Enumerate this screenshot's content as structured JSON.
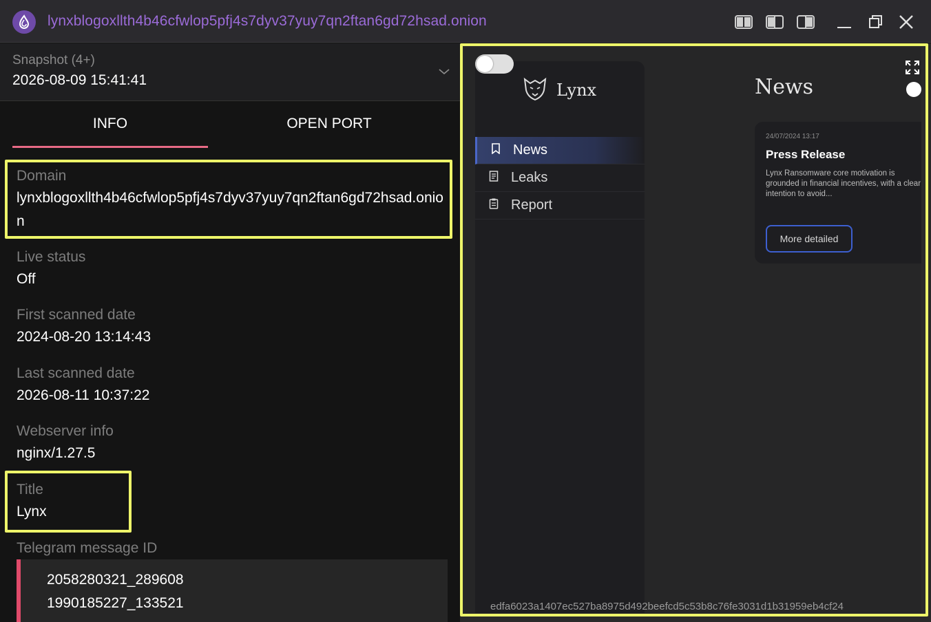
{
  "window": {
    "title": "lynxblogoxllth4b46cfwlop5pfj4s7dyv37yuy7qn2ftan6gd72hsad.onion",
    "accent_color": "#9b6bd8"
  },
  "snapshot": {
    "label": "Snapshot (4+)",
    "value": "2026-08-09 15:41:41"
  },
  "tabs": [
    {
      "label": "INFO",
      "active": true
    },
    {
      "label": "OPEN PORT",
      "active": false
    }
  ],
  "info": {
    "domain": {
      "label": "Domain",
      "value": "lynxblogoxllth4b46cfwlop5pfj4s7dyv37yuy7qn2ftan6gd72hsad.onion"
    },
    "live_status": {
      "label": "Live status",
      "value": "Off"
    },
    "first_scanned": {
      "label": "First scanned date",
      "value": "2024-08-20 13:14:43"
    },
    "last_scanned": {
      "label": "Last scanned date",
      "value": "2026-08-11 10:37:22"
    },
    "webserver": {
      "label": "Webserver info",
      "value": "nginx/1.27.5"
    },
    "title": {
      "label": "Title",
      "value": "Lynx"
    },
    "telegram": {
      "label": "Telegram message ID",
      "values": [
        "2058280321_289608",
        "1990185227_133521"
      ]
    }
  },
  "preview": {
    "brand": "Lynx",
    "nav": [
      {
        "label": "News",
        "icon": "bookmark-icon",
        "active": true
      },
      {
        "label": "Leaks",
        "icon": "document-icon",
        "active": false
      },
      {
        "label": "Report",
        "icon": "clipboard-icon",
        "active": false
      }
    ],
    "heading": "News",
    "card": {
      "date": "24/07/2024 13:17",
      "title": "Press Release",
      "body": "Lynx Ransomware core motivation is grounded in financial incentives, with a clear intention to avoid...",
      "button": "More detailed"
    },
    "hash": "edfa6023a1407ec527ba8975d492beefcd5c53b8c76fe3031d1b31959eb4cf24",
    "highlight_color": "#eef56a"
  }
}
